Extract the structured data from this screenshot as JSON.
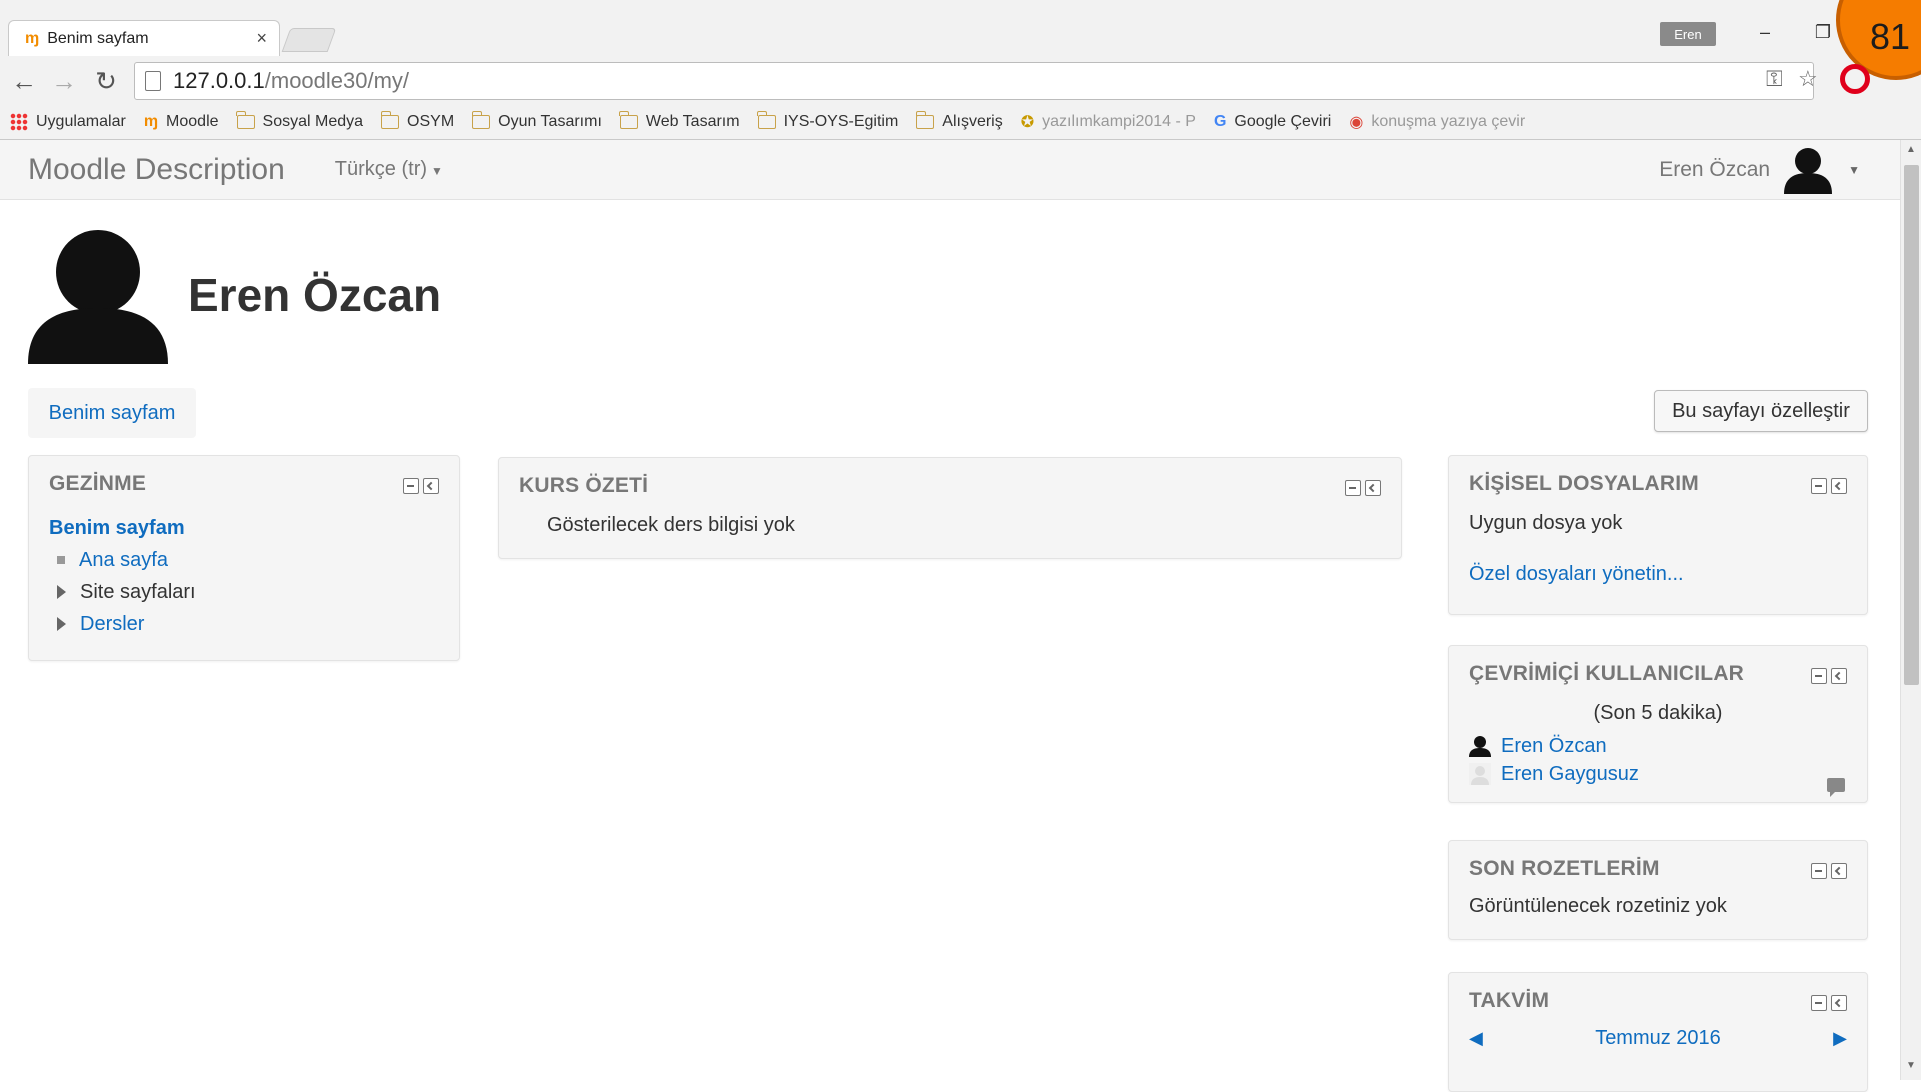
{
  "browser": {
    "tab_title": "Benim sayfam",
    "tab_close": "×",
    "profile_name": "Eren",
    "overlay_number": "81",
    "url_host": "127.0.0.1",
    "url_path": "/moodle30/my/",
    "bookmarks": [
      {
        "label": "Uygulamalar",
        "icon": "apps-grid-icon"
      },
      {
        "label": "Moodle",
        "icon": "moodle-icon"
      },
      {
        "label": "Sosyal Medya",
        "icon": "folder-icon"
      },
      {
        "label": "OSYM",
        "icon": "folder-icon"
      },
      {
        "label": "Oyun Tasarımı",
        "icon": "folder-icon"
      },
      {
        "label": "Web Tasarım",
        "icon": "folder-icon"
      },
      {
        "label": "IYS-OYS-Egitim",
        "icon": "folder-icon"
      },
      {
        "label": "Alışveriş",
        "icon": "folder-icon"
      },
      {
        "label": "yazılımkampi2014 - P",
        "icon": "badge-icon"
      },
      {
        "label": "Google Çeviri",
        "icon": "translate-icon"
      },
      {
        "label": "konuşma yazıya çevir",
        "icon": "chrome-icon"
      }
    ]
  },
  "navbar": {
    "brand": "Moodle Description",
    "language": "Türkçe (tr)",
    "user_name": "Eren Özcan"
  },
  "header": {
    "full_name": "Eren Özcan",
    "breadcrumb": "Benim sayfam",
    "customize_button": "Bu sayfayı özelleştir"
  },
  "blocks": {
    "navigation": {
      "title": "GEZİNME",
      "current": "Benim sayfam",
      "items": [
        {
          "label": "Ana sayfa",
          "type": "leaf",
          "link": true
        },
        {
          "label": "Site sayfaları",
          "type": "branch",
          "link": false
        },
        {
          "label": "Dersler",
          "type": "branch",
          "link": true
        }
      ]
    },
    "course_overview": {
      "title": "KURS ÖZETİ",
      "message": "Gösterilecek ders bilgisi yok"
    },
    "private_files": {
      "title": "KİŞİSEL DOSYALARIM",
      "message": "Uygun dosya yok",
      "manage_link": "Özel dosyaları yönetin..."
    },
    "online_users": {
      "title": "ÇEVRİMİÇİ KULLANICILAR",
      "period": "(Son 5 dakika)",
      "users": [
        "Eren Özcan",
        "Eren Gaygusuz"
      ]
    },
    "badges": {
      "title": "SON ROZETLERİM",
      "message": "Görüntülenecek rozetiniz yok"
    },
    "calendar": {
      "title": "TAKVİM",
      "month": "Temmuz 2016",
      "prev": "◀",
      "next": "▶"
    }
  },
  "colors": {
    "link": "#0f6cbf",
    "block_bg": "#f5f5f5",
    "title_gray": "#777777",
    "accent_orange": "#f57c00"
  }
}
